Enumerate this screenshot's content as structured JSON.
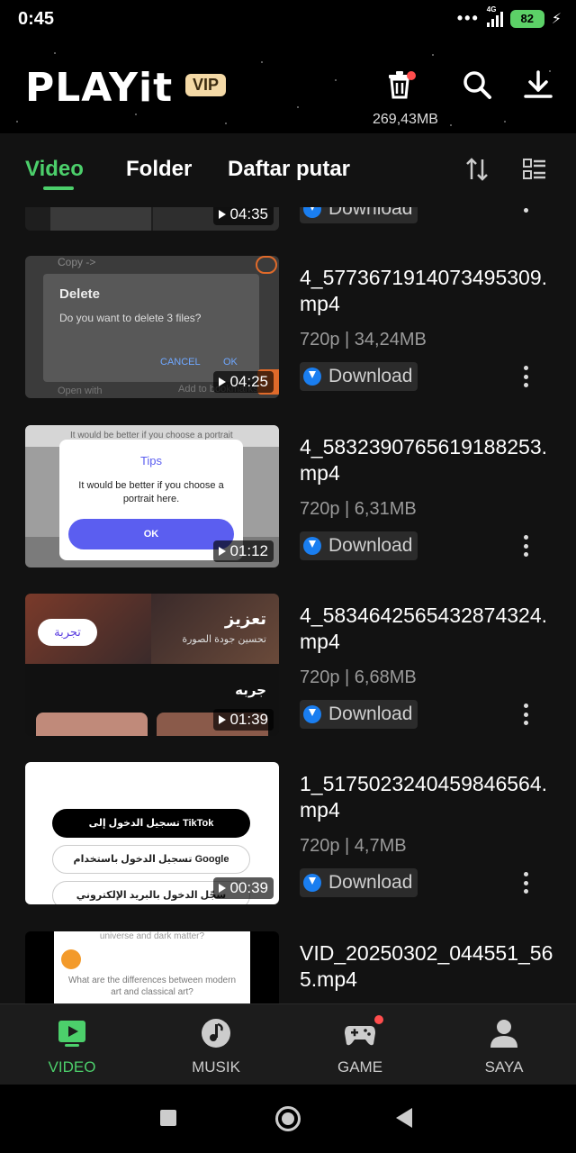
{
  "status_bar": {
    "time": "0:45",
    "network": "4G",
    "battery": "82"
  },
  "header": {
    "logo": "PLAYit",
    "vip_badge": "VIP",
    "trash_size": "269,43MB"
  },
  "tabs": [
    {
      "label": "Video",
      "active": true
    },
    {
      "label": "Folder",
      "active": false
    },
    {
      "label": "Daftar putar",
      "active": false
    }
  ],
  "videos": [
    {
      "title": "",
      "duration": "04:35",
      "meta": "",
      "download_label": "Download"
    },
    {
      "title": "4_5773671914073495309.mp4",
      "duration": "04:25",
      "meta": "720p | 34,24MB",
      "download_label": "Download",
      "thumb": {
        "dialog_title": "Delete",
        "dialog_text": "Do you want to delete 3 files?",
        "cancel": "CANCEL",
        "ok": "OK",
        "copy": "Copy ->",
        "open_with": "Open with",
        "add_bookmarks": "Add to bookmarks"
      }
    },
    {
      "title": "4_5832390765619188253.mp4",
      "duration": "01:12",
      "meta": "720p | 6,31MB",
      "download_label": "Download",
      "thumb": {
        "banner": "It would be better if you choose a portrait here",
        "tips_title": "Tips",
        "tips_text": "It would be better if you choose a portrait here.",
        "ok": "OK"
      }
    },
    {
      "title": "4_5834642565432874324.mp4",
      "duration": "01:39",
      "meta": "720p | 6,68MB",
      "download_label": "Download",
      "thumb": {
        "try_label": "تجربة",
        "heading": "تعزيز",
        "sub": "تحسين جودة الصورة",
        "caption": "جربه"
      }
    },
    {
      "title": "1_5175023240459846564.mp4",
      "duration": "00:39",
      "meta": "720p | 4,7MB",
      "download_label": "Download",
      "thumb": {
        "tiktok": "تسجيل الدخول إلى TikTok",
        "google": "تسجيل الدخول باستخدام Google",
        "email": "سجّل الدخول بالبريد الإلكتروني"
      }
    },
    {
      "title": "VID_20250302_044551_565.mp4",
      "duration": "",
      "meta": "",
      "download_label": "",
      "thumb": {
        "q1": "universe and dark matter?",
        "q2": "What are the differences between modern art and classical art?"
      }
    }
  ],
  "bottom_nav": [
    {
      "label": "VIDEO",
      "icon": "video-icon",
      "active": true
    },
    {
      "label": "MUSIK",
      "icon": "music-icon",
      "active": false
    },
    {
      "label": "GAME",
      "icon": "gamepad-icon",
      "active": false
    },
    {
      "label": "SAYA",
      "icon": "user-icon",
      "active": false
    }
  ],
  "colors": {
    "accent": "#4ccf6b",
    "download": "#1a7ef0",
    "vip_bg": "#f4d9a6",
    "badge": "#ff4d4d"
  }
}
